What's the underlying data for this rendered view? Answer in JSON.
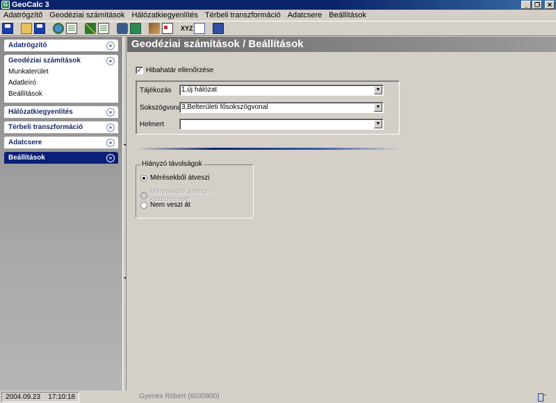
{
  "window": {
    "title": "GeoCalc 3",
    "controls": {
      "minimize": "_",
      "restore": "❐",
      "close": "✕"
    }
  },
  "menu": [
    "Adatrögzítő",
    "Geodéziai számítások",
    "Hálózatkiegyenlítés",
    "Térbeli transzformáció",
    "Adatcsere",
    "Beállítások"
  ],
  "toolbar": {
    "xyz_label": "XYZ"
  },
  "sidebar": {
    "sections": [
      {
        "label": "Adatrögzítő",
        "expanded": false
      },
      {
        "label": "Geodéziai számítások",
        "expanded": true
      },
      {
        "label": "Hálózatkiegyenlítés",
        "expanded": false
      },
      {
        "label": "Térbeli transzformáció",
        "expanded": false
      },
      {
        "label": "Adatcsere",
        "expanded": false
      },
      {
        "label": "Beállítások",
        "expanded": false,
        "active": true
      }
    ],
    "sub_items": [
      "Munkaterület",
      "Adatleíró",
      "Beállítások"
    ]
  },
  "main": {
    "title": "Geodéziai számítások / Beállítások",
    "checkbox": {
      "label": "Hibahatár ellenőrzése",
      "checked": true,
      "mark": "✓"
    },
    "fields": [
      {
        "label": "Tájékozás",
        "value": "1,új hálózat"
      },
      {
        "label": "Sokszögvonal",
        "value": "3,Belterületi fősokszögvonal"
      },
      {
        "label": "Helmert",
        "value": ""
      }
    ],
    "radiogroup": {
      "legend": "Hiányzó távolságok",
      "options": [
        {
          "label": "Mérésekből átveszi",
          "selected": true,
          "enabled": true
        },
        {
          "label": "Mérésekből átveszi - középeléssel",
          "selected": false,
          "enabled": false
        },
        {
          "label": "Nem veszi át",
          "selected": false,
          "enabled": true
        }
      ]
    }
  },
  "status": {
    "date": "2004.09.23",
    "time": "17:10:18",
    "user": "Gyenes Róbert (6030800)"
  },
  "colors": {
    "accent": "#0a246a",
    "sidebar_active": "#0a1f78",
    "header_gray": "#7a7a7a",
    "face": "#d4d0c8"
  }
}
